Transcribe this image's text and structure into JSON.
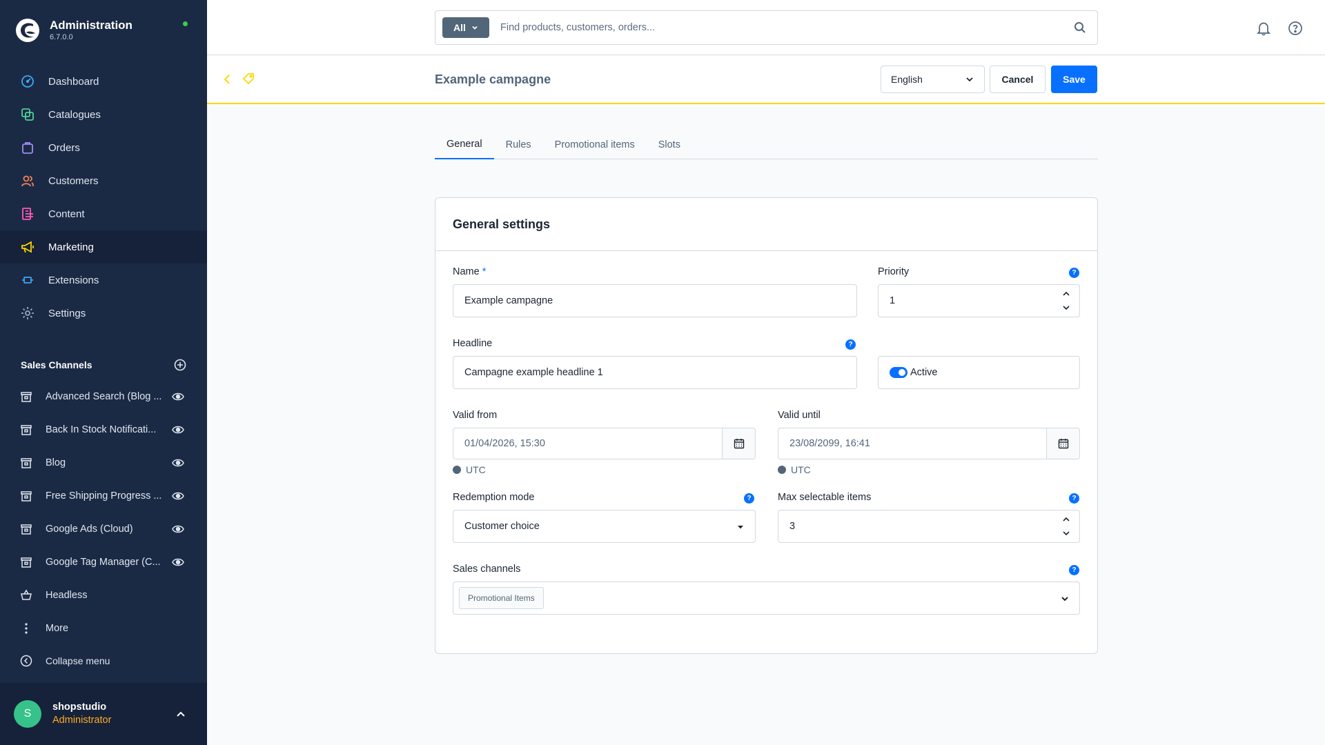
{
  "brand": {
    "title": "Administration",
    "version": "6.7.0.0"
  },
  "nav": {
    "items": [
      {
        "label": "Dashboard",
        "icon": "dashboard-icon"
      },
      {
        "label": "Catalogues",
        "icon": "catalogues-icon"
      },
      {
        "label": "Orders",
        "icon": "orders-icon"
      },
      {
        "label": "Customers",
        "icon": "customers-icon"
      },
      {
        "label": "Content",
        "icon": "content-icon"
      },
      {
        "label": "Marketing",
        "icon": "marketing-icon",
        "active": true
      },
      {
        "label": "Extensions",
        "icon": "extensions-icon"
      },
      {
        "label": "Settings",
        "icon": "settings-icon"
      }
    ]
  },
  "sales_channels": {
    "title": "Sales Channels",
    "items": [
      {
        "label": "Advanced Search (Blog ..."
      },
      {
        "label": "Back In Stock Notificati..."
      },
      {
        "label": "Blog"
      },
      {
        "label": "Free Shipping Progress ..."
      },
      {
        "label": "Google Ads (Cloud)"
      },
      {
        "label": "Google Tag Manager (C..."
      },
      {
        "label": "Headless"
      }
    ],
    "more": "More",
    "collapse": "Collapse menu"
  },
  "user": {
    "initial": "S",
    "name": "shopstudio",
    "role": "Administrator"
  },
  "search": {
    "type": "All",
    "placeholder": "Find products, customers, orders..."
  },
  "smartbar": {
    "title": "Example campagne",
    "language": "English",
    "cancel": "Cancel",
    "save": "Save"
  },
  "tabs": [
    {
      "label": "General",
      "active": true
    },
    {
      "label": "Rules"
    },
    {
      "label": "Promotional items"
    },
    {
      "label": "Slots"
    }
  ],
  "card": {
    "title": "General settings",
    "name": {
      "label": "Name",
      "required": "*",
      "value": "Example campagne"
    },
    "priority": {
      "label": "Priority",
      "value": "1"
    },
    "headline": {
      "label": "Headline",
      "value": "Campagne example headline 1"
    },
    "active": {
      "label": "Active",
      "on": true
    },
    "valid_from": {
      "label": "Valid from",
      "value": "01/04/2026, 15:30",
      "tz": "UTC"
    },
    "valid_until": {
      "label": "Valid until",
      "value": "23/08/2099, 16:41",
      "tz": "UTC"
    },
    "redemption_mode": {
      "label": "Redemption mode",
      "value": "Customer choice"
    },
    "max_items": {
      "label": "Max selectable items",
      "value": "3"
    },
    "sales_channels": {
      "label": "Sales channels",
      "chip": "Promotional Items"
    }
  },
  "colors": {
    "sidebar": "#1b2a44",
    "accent": "#0870ff",
    "highlight": "#ffd700",
    "role": "#ffab22"
  }
}
